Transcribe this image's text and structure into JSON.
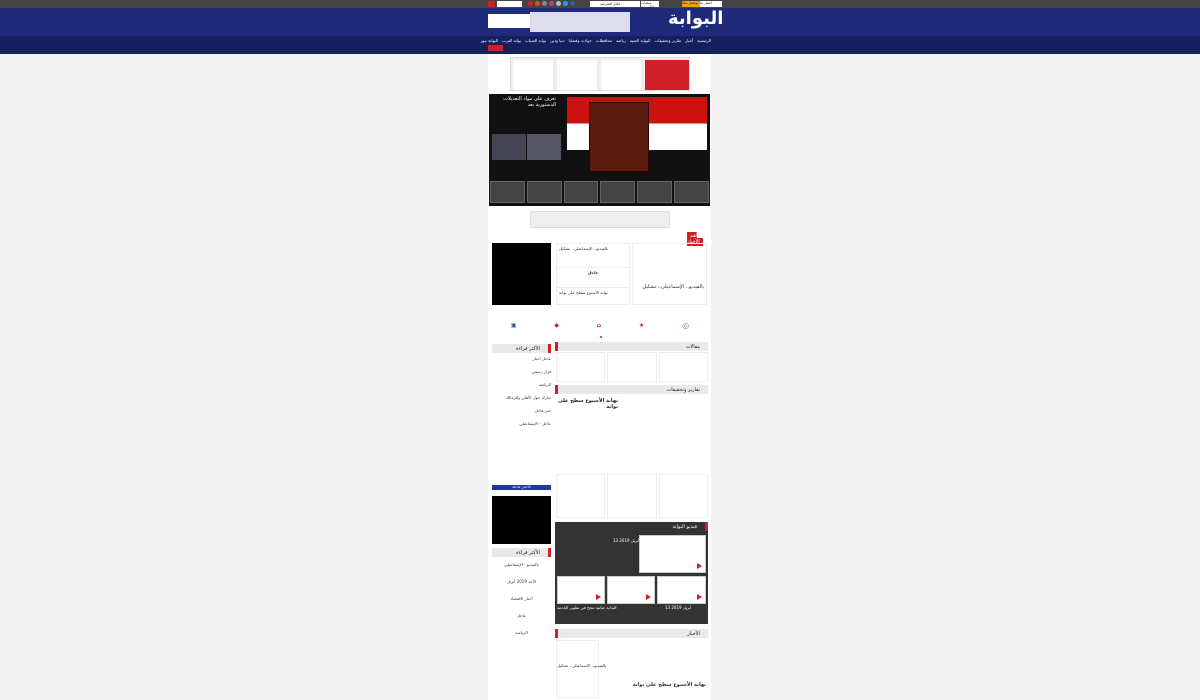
{
  "header": {
    "logo": "البوابة",
    "top_links": [
      "الحكام الشرعية",
      "Ads",
      "منصات إلكترونية",
      "تواصل معنا",
      "اتصل بنا"
    ],
    "nav_items": [
      "الرئيسية",
      "أخبار",
      "تقارير وتحقيقات",
      "البوابة الجنية",
      "رياضة",
      "محافظات",
      "حوادث وقضايا",
      "دنيا ودين",
      "بوابة الشباب",
      "بوابة العرب",
      "البوابة نيوز"
    ]
  },
  "hero": {
    "headline": "تعرف على مواد التعديلات الدستورية بعد"
  },
  "sections": {
    "latest_news": "أهم الأخبار",
    "articles": "مقالات",
    "reports": "تقارير وتحقيقات",
    "videos": "فيديو البوابة",
    "news": "الأخبار",
    "breaking": "الأكثر قراءة",
    "most_read": "الأكثر قراءة",
    "follow": "الأخبار عاجلة"
  },
  "news_items": {
    "n1": "بالفيديو.. الإسماعيلي.. تشكيل",
    "n2": "نهاية الأسبوع سطح على بوابة",
    "n3": "عاجل"
  },
  "sidebar": {
    "items": [
      "عاجل أخبار",
      "قرار رسمي",
      "الرياضة",
      "تدارك حول الأهلي والزمالك",
      "خبر عاجل",
      "عاجل - الإسماعيلي",
      "بالفيديو - الإسماعيلي",
      "أخبار الاقتصاد",
      "عاجل"
    ]
  },
  "video": {
    "date": "13 أبريل 2019",
    "captions": [
      "البداية حياتية تنجح في تطوير الخدمة",
      "الأحد 2019 أبريل"
    ]
  }
}
